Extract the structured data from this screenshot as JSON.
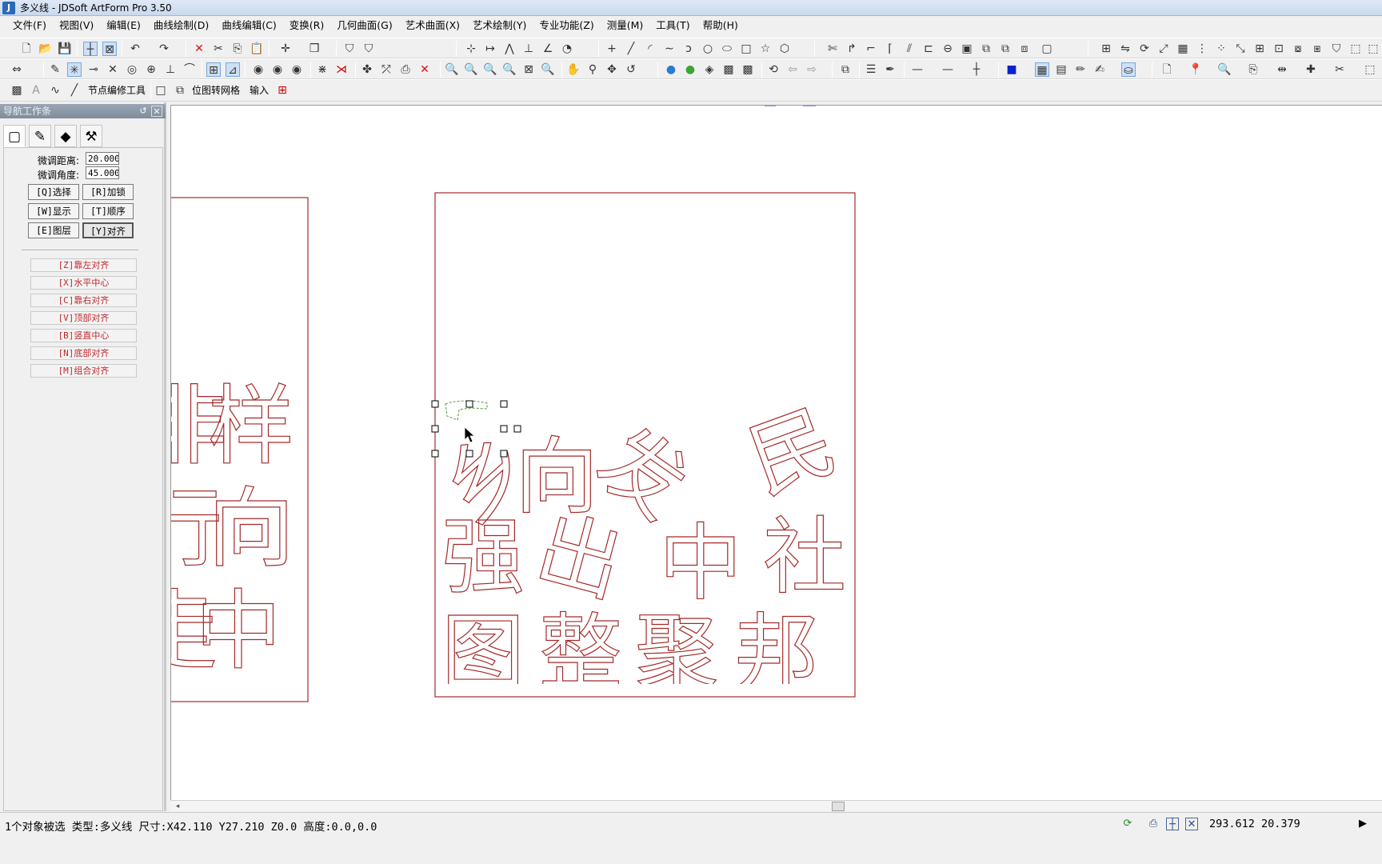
{
  "window": {
    "title": "多义线 - JDSoft ArtForm Pro 3.50"
  },
  "menu": [
    "文件(F)",
    "视图(V)",
    "编辑(E)",
    "曲线绘制(D)",
    "曲线编辑(C)",
    "变换(R)",
    "几何曲面(G)",
    "艺术曲面(X)",
    "艺术绘制(Y)",
    "专业功能(Z)",
    "测量(M)",
    "工具(T)",
    "帮助(H)"
  ],
  "toolbar3": {
    "node_tool_label": "节点编修工具",
    "bitmap_grid_label": "位图转网格",
    "input_label": "输入"
  },
  "nav": {
    "title": "导航工作条",
    "fine_distance_label": "微调距离:",
    "fine_distance_value": "20.000",
    "fine_angle_label": "微调角度:",
    "fine_angle_value": "45.000",
    "buttons": [
      "[Q]选择",
      "[R]加锁",
      "[W]显示",
      "[T]顺序",
      "[E]图层",
      "[Y]对齐"
    ],
    "align_buttons": [
      "[Z]靠左对齐",
      "[X]水平中心",
      "[C]靠右对齐",
      "[V]顶部对齐",
      "[B]竖直中心",
      "[N]底部对齐",
      "[M]组合对齐"
    ]
  },
  "canvas": {
    "left_panel_chars": [
      "非",
      "样",
      "行",
      "向",
      "走",
      "中"
    ],
    "right_panel_chars": [
      "乡",
      "向",
      "发",
      "民",
      "强",
      "出",
      "中",
      "社",
      "图",
      "整",
      "聚",
      "邦"
    ]
  },
  "status": {
    "selection_text": "1个对象被选 类型:多义线 尺寸:X42.110 Y27.210 Z0.0 高度:0.0,0.0",
    "coords": "293.612 20.379"
  },
  "colors": {
    "outline": "#a52a2a",
    "selected_curve": "#6aa84f",
    "titlebar": "#c9d9ee"
  }
}
